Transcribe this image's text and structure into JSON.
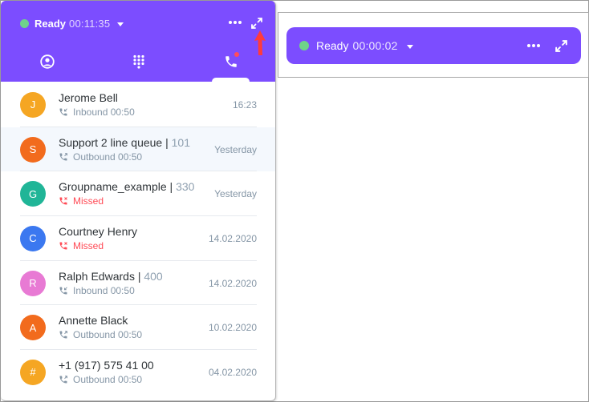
{
  "expanded_widget": {
    "status": {
      "label": "Ready",
      "timer": "00:11:35",
      "indicator_color": "#6fd38a"
    },
    "header_color": "#7c4dff",
    "header_icons": [
      "more-icon",
      "expand-icon"
    ],
    "tabs": [
      {
        "name": "contacts",
        "icon": "user-circle-icon",
        "active": false
      },
      {
        "name": "dialpad",
        "icon": "dialpad-icon",
        "active": false
      },
      {
        "name": "calls",
        "icon": "phone-icon",
        "active": true,
        "has_badge": true
      }
    ],
    "calls": [
      {
        "initial": "J",
        "avatar_color": "#f5a623",
        "name": "Jerome Bell",
        "ext": "",
        "direction": "inbound",
        "detail": "Inbound 00:50",
        "date": "16:23",
        "highlight": false
      },
      {
        "initial": "S",
        "avatar_color": "#f26b1d",
        "name": "Support 2 line queue",
        "ext": "101",
        "direction": "outbound",
        "detail": "Outbound 00:50",
        "date": "Yesterday",
        "highlight": true
      },
      {
        "initial": "G",
        "avatar_color": "#20b597",
        "name": "Groupname_example",
        "ext": "330",
        "direction": "missed",
        "detail": "Missed",
        "date": "Yesterday",
        "highlight": false
      },
      {
        "initial": "C",
        "avatar_color": "#3b78f0",
        "name": "Courtney Henry",
        "ext": "",
        "direction": "missed",
        "detail": "Missed",
        "date": "14.02.2020",
        "highlight": false
      },
      {
        "initial": "R",
        "avatar_color": "#e87ad4",
        "name": "Ralph Edwards",
        "ext": "400",
        "direction": "inbound",
        "detail": "Inbound 00:50",
        "date": "14.02.2020",
        "highlight": false
      },
      {
        "initial": "A",
        "avatar_color": "#f26b1d",
        "name": "Annette Black",
        "ext": "",
        "direction": "outbound",
        "detail": "Outbound 00:50",
        "date": "10.02.2020",
        "highlight": false
      },
      {
        "initial": "#",
        "avatar_color": "#f5a623",
        "name": "+1 (917) 575 41 00",
        "ext": "",
        "direction": "outbound",
        "detail": "Outbound 00:50",
        "date": "04.02.2020",
        "highlight": false
      }
    ]
  },
  "collapsed_widget": {
    "status": {
      "label": "Ready",
      "timer": "00:00:02",
      "indicator_color": "#6fd38a"
    },
    "header_icons": [
      "more-icon",
      "expand-icon"
    ]
  },
  "annotation": {
    "type": "red-arrow",
    "points_to": "expand-icon",
    "color": "#ff3b3b"
  }
}
